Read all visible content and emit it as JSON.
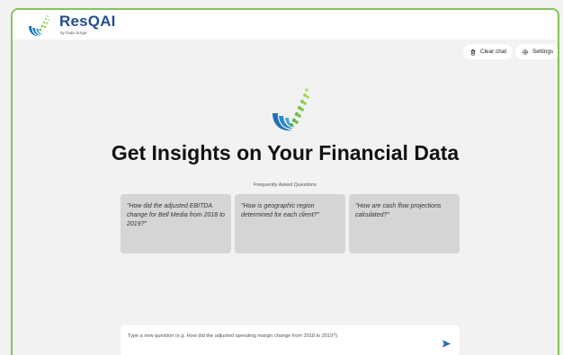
{
  "brand": {
    "name": "ResQAI",
    "tagline": "by Data Surge"
  },
  "toolbar": {
    "clear_label": "Clear chat",
    "settings_label": "Settings"
  },
  "main": {
    "headline": "Get Insights on Your Financial Data",
    "faq_title": "Frequently Asked Questions",
    "faq": [
      {
        "text": "\"How did the adjusted EBITDA change for Bell Media from 2018 to 2019?\""
      },
      {
        "text": "\"How is geographic region determined for each client?\""
      },
      {
        "text": "\"How are cash flow projections calculated?\""
      }
    ]
  },
  "composer": {
    "placeholder": "Type a new question (e.g. How did the adjusted operating margin change from 2018 to 2019?)"
  },
  "colors": {
    "frame_border": "#86c45a",
    "brand_blue": "#234d8d",
    "logo_green": "#7cc242",
    "logo_blue": "#1f6fb5",
    "card_bg": "#d5d5d5",
    "send_icon": "#2d6ea8"
  },
  "icons": {
    "clear": "trash-icon",
    "settings": "gear-icon",
    "send": "send-icon",
    "logo": "resqai-logo-icon"
  }
}
